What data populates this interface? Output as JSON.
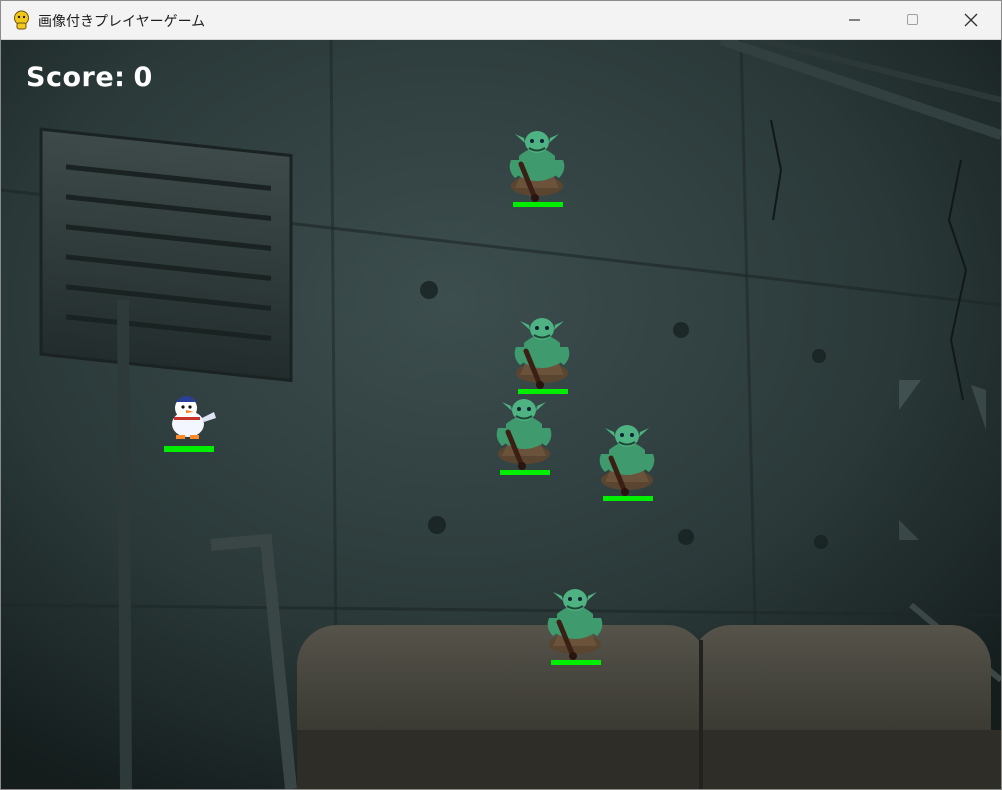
{
  "window": {
    "title": "画像付きプレイヤーゲーム",
    "icon": "python-game-icon",
    "buttons": [
      "minimize-icon",
      "maximize-icon",
      "close-icon"
    ]
  },
  "hud": {
    "score_label": "Score:",
    "score_value": "0"
  },
  "colors": {
    "health_bar": "#00ee00",
    "titlebar_bg": "#f3f3f3",
    "scene_bg": "#263333"
  },
  "player": {
    "sprite": "snowman-player",
    "health": 1.0
  },
  "enemies": [
    {
      "sprite": "green-goblin-enemy",
      "health": 1.0
    },
    {
      "sprite": "green-goblin-enemy",
      "health": 1.0
    },
    {
      "sprite": "green-goblin-enemy",
      "health": 1.0
    },
    {
      "sprite": "green-goblin-enemy",
      "health": 1.0
    },
    {
      "sprite": "green-goblin-enemy",
      "health": 1.0
    }
  ]
}
